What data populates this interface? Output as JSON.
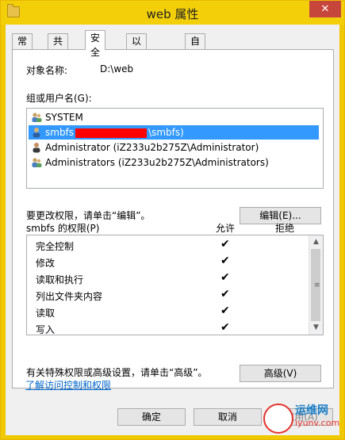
{
  "window": {
    "title": "web 属性",
    "close_glyph": "✕"
  },
  "tabs": [
    {
      "label": "常规"
    },
    {
      "label": "共享"
    },
    {
      "label": "安全"
    },
    {
      "label": "以前的版本"
    },
    {
      "label": "自定义"
    }
  ],
  "security": {
    "object_name_label": "对象名称:",
    "object_name_value": "D:\\web",
    "group_users_label": "组或用户名(G):",
    "users": [
      {
        "name": "SYSTEM",
        "icon": "users-group-icon"
      },
      {
        "name_prefix": "smbfs",
        "name_suffix": "\\smbfs)",
        "icon": "user-icon",
        "selected": true
      },
      {
        "name": "Administrator (iZ233u2b275Z\\Administrator)",
        "icon": "user-icon"
      },
      {
        "name": "Administrators (iZ233u2b275Z\\Administrators)",
        "icon": "users-group-icon"
      }
    ],
    "edit_hint": "要更改权限，请单击“编辑”。",
    "edit_button": "编辑(E)...",
    "perm_title": "smbfs 的权限(P)",
    "allow_header": "允许",
    "deny_header": "拒绝",
    "permissions": [
      {
        "name": "完全控制",
        "allow": true
      },
      {
        "name": "修改",
        "allow": true
      },
      {
        "name": "读取和执行",
        "allow": true
      },
      {
        "name": "列出文件夹内容",
        "allow": true
      },
      {
        "name": "读取",
        "allow": true
      },
      {
        "name": "写入",
        "allow": true
      }
    ],
    "check_glyph": "✔",
    "advanced_hint": "有关特殊权限或高级设置，请单击“高级”。",
    "advanced_button": "高级(V)",
    "learn_link": "了解访问控制和权限"
  },
  "footer": {
    "ok": "确定",
    "cancel": "取消",
    "apply": "应用(A)"
  },
  "watermark": {
    "text1": "运维网",
    "text2": "iyunv.com"
  }
}
